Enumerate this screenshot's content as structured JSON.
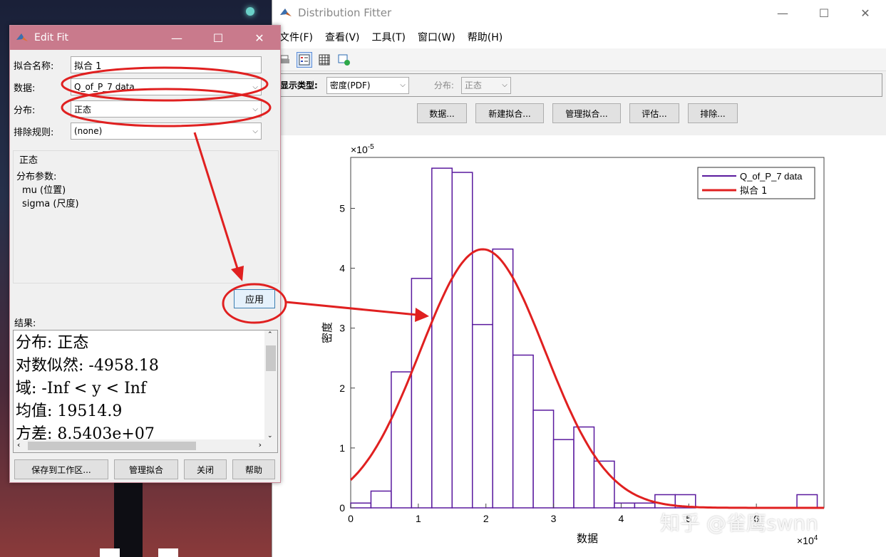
{
  "main_window": {
    "title": "Distribution Fitter",
    "menu": [
      "文件(F)",
      "查看(V)",
      "工具(T)",
      "窗口(W)",
      "帮助(H)"
    ],
    "display_type_label": "显示类型:",
    "display_type_value": "密度(PDF)",
    "dist_label": "分布:",
    "dist_value": "正态",
    "buttons": [
      "数据...",
      "新建拟合...",
      "管理拟合...",
      "评估...",
      "排除..."
    ]
  },
  "edit_window": {
    "title": "Edit Fit",
    "fit_name_label": "拟合名称:",
    "fit_name_value": "拟合 1",
    "data_label": "数据:",
    "data_value": "Q_of_P_7 data",
    "dist_label": "分布:",
    "dist_value": "正态",
    "exclusion_label": "排除规则:",
    "exclusion_value": "(none)",
    "dist_name": "正态",
    "params_label": "分布参数:",
    "param1": "mu (位置)",
    "param2": "sigma (尺度)",
    "apply": "应用",
    "results_label": "结果:",
    "results_lines": [
      "分布: 正态",
      "对数似然: -4958.18",
      "域: -Inf < y < Inf",
      "均值: 19514.9",
      "方差: 8.5403e+07"
    ],
    "buttons": [
      "保存到工作区...",
      "管理拟合",
      "关闭",
      "帮助"
    ]
  },
  "chart_data": {
    "type": "bar",
    "xlabel": "数据",
    "ylabel": "密度",
    "x_exponent": "×10^4",
    "y_exponent": "×10^-5",
    "xlim": [
      0,
      7
    ],
    "ylim": [
      0,
      5.85
    ],
    "xticks": [
      0,
      1,
      2,
      3,
      4,
      5,
      6
    ],
    "yticks": [
      0,
      1,
      2,
      3,
      4,
      5
    ],
    "bin_width": 0.3,
    "bins_start": [
      0.0,
      0.3,
      0.6,
      0.9,
      1.2,
      1.5,
      1.8,
      2.1,
      2.4,
      2.7,
      3.0,
      3.3,
      3.6,
      3.9,
      4.2,
      4.5,
      4.8,
      5.1,
      5.4,
      5.7,
      6.0,
      6.3,
      6.6
    ],
    "bin_values": [
      0.08,
      0.28,
      2.27,
      3.83,
      5.67,
      5.6,
      3.06,
      4.32,
      2.55,
      1.63,
      1.14,
      1.35,
      0.78,
      0.08,
      0.08,
      0.22,
      0.22,
      0,
      0,
      0,
      0,
      0,
      0.22
    ],
    "series": [
      {
        "name": "Q_of_P_7 data",
        "color": "#5a1a9e"
      },
      {
        "name": "拟合 1",
        "color": "#e02020",
        "mu": 1.95149,
        "sigma": 0.92414
      }
    ]
  },
  "watermark": "知乎 @雀鹰swnn"
}
